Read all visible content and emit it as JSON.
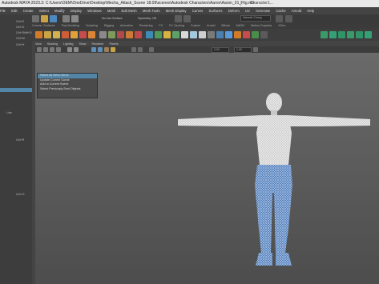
{
  "window": {
    "title": "Autodesk MAYA 2023.3: C:\\Users\\OEM\\OneDrive\\Desktop\\Mecha_Attack_Scene 18.09\\scenes\\Autodesk Characters\\Aaron\\Aaron_01_Rig.mb",
    "right_title": "Character1..."
  },
  "menubar": [
    "File",
    "Edit",
    "Create",
    "Select",
    "Modify",
    "Display",
    "Windows",
    "Mesh",
    "Edit Mesh",
    "Mesh Tools",
    "Mesh Display",
    "Curves",
    "Surfaces",
    "Deform",
    "UV",
    "Generate",
    "Cache",
    "Arnold",
    "Help"
  ],
  "status": {
    "live_surface": "No Live Surface",
    "symmetry": "Symmetry: Off",
    "user": "Hannah Chong"
  },
  "shelf_tabs": [
    "Curves / Surfaces",
    "Poly Modeling",
    "Sculpting",
    "Rigging",
    "Animation",
    "Rendering",
    "FX",
    "FX Caching",
    "Custom",
    "Arnold",
    "Bifrost",
    "MASH",
    "Motion Graphics",
    "XGen"
  ],
  "left_panel": {
    "hotkeys": [
      "Ctrl+E",
      "Ctrl+D",
      "Ctrl+Shift+D",
      "Ctrl+M",
      "Ctrl+H"
    ],
    "lower_hotkeys": [
      "Ctrl+R",
      "Ctrl+G"
    ],
    "label_line": "Line"
  },
  "viewport": {
    "menus": [
      "View",
      "Shading",
      "Lighting",
      "Show",
      "Renderer",
      "Panels"
    ],
    "field_a": "0.00",
    "field_b": "1.00"
  },
  "context_menu": {
    "items": [
      "Select All Menu Items",
      "Update Current Scene",
      "Add to Current Scene",
      "Select Previously Sent Objects"
    ]
  },
  "colors": {
    "accent": "#5285a6",
    "panel": "#444444",
    "mesh_upper": "#e0e0e0",
    "mesh_lower": "#6aa0d8"
  }
}
